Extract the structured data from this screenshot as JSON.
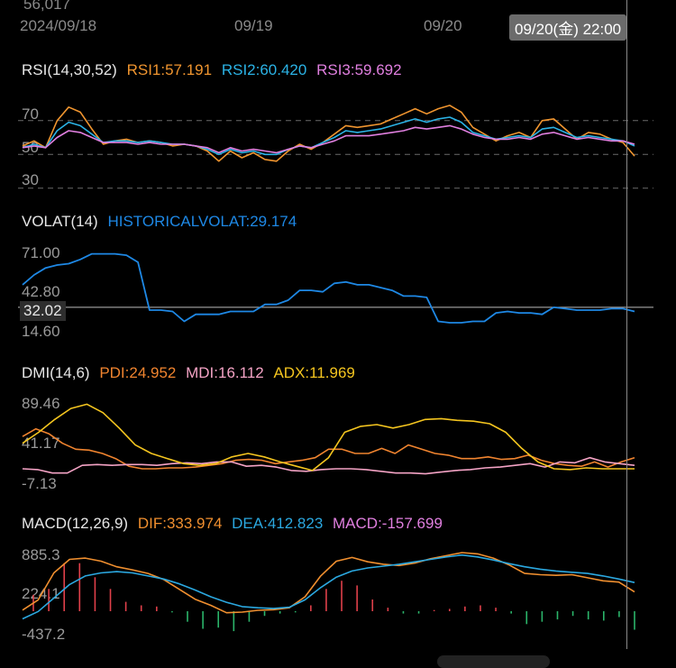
{
  "top_clip_value": "56,017",
  "time_axis": {
    "labels": [
      "2024/09/18",
      "09/19",
      "09/20"
    ],
    "cursor_time": "09/20(金) 22:00"
  },
  "rsi": {
    "header": "RSI(14,30,52)",
    "rsi1": "RSI1:57.191",
    "rsi2": "RSI2:60.420",
    "rsi3": "RSI3:59.692",
    "levels": [
      "70",
      "50",
      "30"
    ],
    "colors": {
      "rsi1": "#f0952f",
      "rsi2": "#2bb3e6",
      "rsi3": "#e07fdf"
    },
    "chart_data": {
      "type": "line",
      "ylim": [
        24,
        88
      ],
      "reference_lines": [
        70,
        50,
        30
      ],
      "series": [
        {
          "name": "RSI1",
          "values": [
            55,
            58,
            54,
            70,
            78,
            75,
            65,
            56,
            58,
            59,
            57,
            58,
            57,
            55,
            56,
            55,
            52,
            46,
            52,
            48,
            51,
            47,
            46,
            52,
            56,
            53,
            57,
            62,
            67,
            66,
            67,
            68,
            71,
            74,
            77,
            74,
            77,
            79,
            75,
            66,
            62,
            58,
            61,
            63,
            60,
            70,
            71,
            65,
            59,
            63,
            62,
            59,
            57,
            49
          ]
        },
        {
          "name": "RSI2",
          "values": [
            54,
            56,
            54,
            64,
            69,
            67,
            62,
            57,
            58,
            58,
            57,
            58,
            57,
            56,
            56,
            55,
            53,
            50,
            53,
            51,
            52,
            50,
            50,
            53,
            55,
            54,
            57,
            60,
            64,
            63,
            64,
            65,
            67,
            69,
            71,
            69,
            71,
            72,
            69,
            63,
            61,
            59,
            60,
            61,
            60,
            65,
            66,
            63,
            60,
            61,
            60,
            59,
            58,
            55
          ]
        },
        {
          "name": "RSI3",
          "values": [
            54,
            55,
            54,
            60,
            64,
            63,
            60,
            57,
            57,
            57,
            56,
            57,
            56,
            56,
            56,
            55,
            54,
            51,
            54,
            52,
            53,
            52,
            51,
            53,
            55,
            54,
            56,
            58,
            61,
            61,
            61,
            62,
            63,
            64,
            66,
            65,
            66,
            67,
            65,
            62,
            60,
            59,
            59,
            60,
            59,
            62,
            63,
            61,
            59,
            60,
            59,
            58,
            58,
            56
          ]
        }
      ]
    }
  },
  "volat": {
    "header": "VOLAT(14)",
    "value": "HISTORICALVOLAT:29.174",
    "axis": [
      "71.00",
      "42.80",
      "14.60"
    ],
    "cursor_value": "32.02",
    "color": "#1e88e5",
    "chart_data": {
      "type": "line",
      "ylim": [
        14.6,
        71.0
      ],
      "series": [
        {
          "name": "HISTORICALVOLAT",
          "values": [
            48,
            55,
            60,
            62,
            63,
            66,
            70,
            70,
            70,
            69,
            64,
            30,
            30,
            29,
            22,
            27,
            27,
            27,
            29,
            29,
            29,
            34,
            34,
            37,
            44,
            44,
            43,
            49,
            50,
            48,
            48,
            46,
            44,
            40,
            40,
            39,
            22,
            21,
            21,
            22,
            22,
            28,
            29,
            28,
            28,
            27,
            32,
            31,
            30,
            30,
            30,
            31,
            31,
            29
          ]
        }
      ]
    }
  },
  "dmi": {
    "header": "DMI(14,6)",
    "pdi": "PDI:24.952",
    "mdi": "MDI:16.112",
    "adx": "ADX:11.969",
    "axis": [
      "89.46",
      "41.17",
      "-7.13"
    ],
    "colors": {
      "pdi": "#f0842f",
      "mdi": "#f4a3c5",
      "adx": "#f4c51f"
    },
    "chart_data": {
      "type": "line",
      "ylim": [
        -7.13,
        89.46
      ],
      "series": [
        {
          "name": "PDI",
          "values": [
            50,
            59,
            53,
            42,
            35,
            34,
            30,
            24,
            15,
            12,
            12,
            13,
            13,
            14,
            16,
            18,
            22,
            23,
            22,
            18,
            20,
            22,
            25,
            35,
            35,
            30,
            30,
            36,
            30,
            40,
            35,
            30,
            28,
            24,
            24,
            26,
            23,
            24,
            28,
            22,
            18,
            16,
            15,
            20,
            14,
            20,
            25
          ]
        },
        {
          "name": "MDI",
          "values": [
            12,
            11,
            7,
            7,
            16,
            17,
            16,
            17,
            17,
            16,
            18,
            19,
            18,
            20,
            20,
            15,
            16,
            14,
            10,
            9,
            11,
            12,
            12,
            11,
            9,
            7,
            7,
            6,
            8,
            10,
            11,
            13,
            14,
            16,
            18,
            14,
            20,
            19,
            25,
            20,
            18,
            16
          ]
        },
        {
          "name": "ADX",
          "values": [
            42,
            55,
            70,
            83,
            88,
            78,
            60,
            40,
            30,
            24,
            18,
            16,
            18,
            26,
            30,
            26,
            20,
            15,
            10,
            25,
            55,
            62,
            64,
            60,
            64,
            70,
            71,
            69,
            68,
            65,
            55,
            36,
            20,
            12,
            11,
            13,
            12,
            12,
            12
          ]
        }
      ]
    }
  },
  "macd": {
    "header": "MACD(12,26,9)",
    "dif": "DIF:333.974",
    "dea": "DEA:412.823",
    "macd_val": "MACD:-157.699",
    "axis": [
      "885.3",
      "224.1",
      "-437.2"
    ],
    "colors": {
      "dif": "#f08f2f",
      "dea": "#2ba8e0",
      "hist_pos": "#e0404a",
      "hist_neg": "#2bb56a"
    },
    "chart_data": {
      "type": "line",
      "ylim": [
        -437.2,
        885.3
      ],
      "series": [
        {
          "name": "DIF",
          "values": [
            -37,
            130,
            570,
            790,
            810,
            760,
            670,
            620,
            560,
            460,
            300,
            140,
            40,
            -80,
            -70,
            -40,
            -30,
            0,
            180,
            520,
            760,
            820,
            750,
            710,
            690,
            730,
            800,
            850,
            900,
            880,
            810,
            700,
            560,
            540,
            530,
            540,
            490,
            440,
            420,
            260
          ]
        },
        {
          "name": "DEA",
          "values": [
            -180,
            -60,
            160,
            380,
            520,
            570,
            590,
            570,
            520,
            470,
            390,
            290,
            180,
            90,
            20,
            0,
            -10,
            10,
            130,
            330,
            500,
            600,
            650,
            680,
            710,
            750,
            790,
            830,
            860,
            830,
            780,
            720,
            670,
            630,
            600,
            580,
            560,
            520,
            470,
            412
          ]
        },
        {
          "name": "MACD",
          "values": [
            140,
            190,
            410,
            410,
            290,
            190,
            80,
            50,
            40,
            -10,
            -90,
            -150,
            -140,
            -170,
            -90,
            -40,
            -20,
            -10,
            50,
            190,
            260,
            220,
            100,
            30,
            -20,
            -20,
            10,
            20,
            40,
            50,
            30,
            -20,
            -110,
            -90,
            -70,
            -40,
            -70,
            -80,
            -50,
            -158
          ]
        }
      ]
    }
  }
}
